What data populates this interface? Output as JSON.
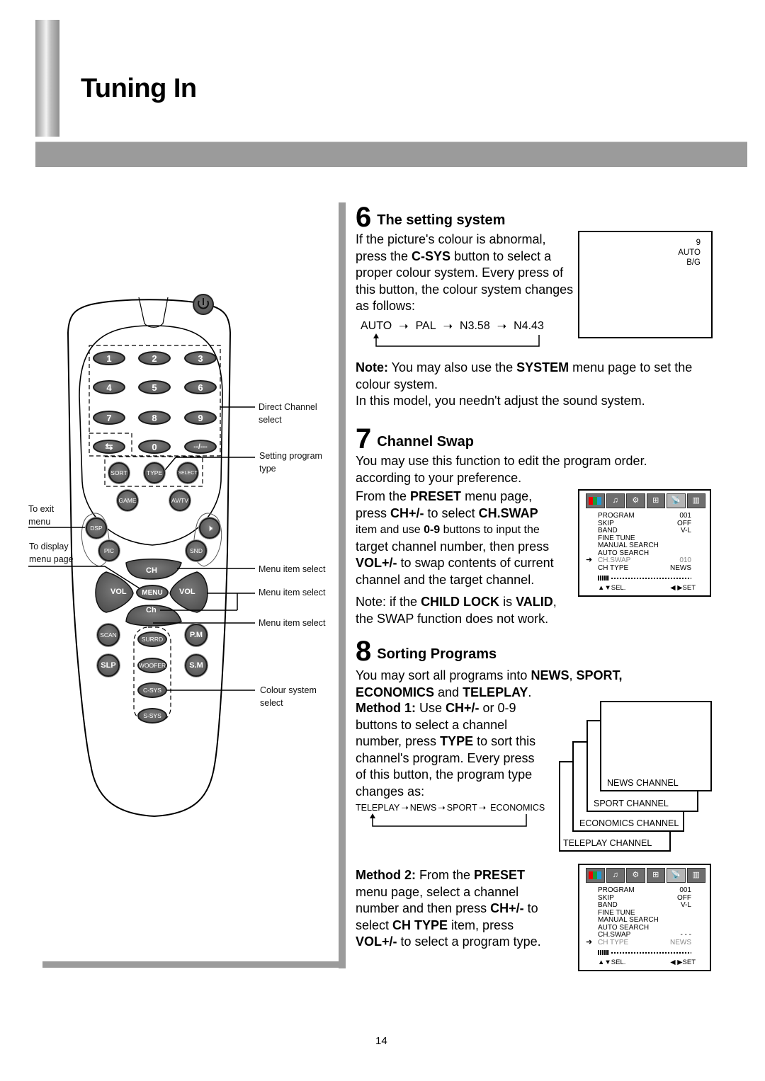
{
  "page": {
    "title": "Tuning In",
    "page_number": "14"
  },
  "remote": {
    "number_buttons": [
      "1",
      "2",
      "3",
      "4",
      "5",
      "6",
      "7",
      "8",
      "9"
    ],
    "row4_buttons": {
      "recall_icon": "recall-arrows-icon",
      "zero": "0",
      "digit_mode": "--/---"
    },
    "program_type_buttons": [
      "SORT",
      "TYPE",
      "SELECT"
    ],
    "mode_buttons": [
      "GAME",
      "AV/TV"
    ],
    "left_cluster": [
      "DSP",
      "PIC"
    ],
    "right_cluster": {
      "mute_icon": "mute-icon",
      "sound": "SND"
    },
    "dpad": {
      "ch_up": "CH",
      "ch_down": "Ch",
      "vol_left": "VOL",
      "vol_right": "VOL",
      "menu": "MENU"
    },
    "lower_left": [
      "SCAN",
      "SLP"
    ],
    "lower_center": [
      "SURRD",
      "WOOFER",
      "C-SYS",
      "S-SYS"
    ],
    "lower_right": [
      "P.M",
      "S.M"
    ],
    "callouts": {
      "direct_channel": "Direct Channel select",
      "setting_program": "Setting program type",
      "menu_item_1": "Menu item select",
      "menu_item_2": "Menu item select",
      "menu_item_3": "Menu item select",
      "colour_system": "Colour system select",
      "exit_menu": "To exit menu",
      "display_menu": "To display menu page"
    }
  },
  "section6": {
    "number": "6",
    "title": "The setting system",
    "p1_a": "If the picture's colour is abnormal, press the ",
    "p1_b": "C-SYS",
    "p1_c": " button to select a proper colour system. Every press of this button, the colour system changes as follows:",
    "sequence": [
      "AUTO",
      "PAL",
      "N3.58",
      "N4.43"
    ],
    "screen_lines": [
      "9",
      "AUTO",
      "B/G"
    ],
    "note_label": "Note:",
    "note_a": " You may also use the ",
    "note_b": "SYSTEM",
    "note_c": " menu page to set the colour system.",
    "note2": "In this model, you needn't adjust the sound system."
  },
  "section7": {
    "number": "7",
    "title": "Channel Swap",
    "intro": "You may use this function to edit the program order. according to your preference.",
    "t1": "From the ",
    "t1b": "PRESET",
    "t1c": " menu page,",
    "t2": "press ",
    "t2b": "CH+/-",
    "t2c": " to select ",
    "t2d": "CH.SWAP",
    "t3": "item and use ",
    "t3b": "0-9",
    "t3c": " buttons to input the",
    "t4": "target channel number, then press",
    "t5b": "VOL+/-",
    "t5c": " to swap contents of current",
    "t6": "channel and the target channel.",
    "note_a": "Note: if the ",
    "note_b": "CHILD LOCK",
    "note_c": " is ",
    "note_d": "VALID",
    "note_e": ",",
    "note2": "the SWAP function does not work.",
    "osd": {
      "rows": [
        {
          "label": "PROGRAM",
          "value": "001"
        },
        {
          "label": "SKIP",
          "value": "OFF"
        },
        {
          "label": "BAND",
          "value": "V-L"
        },
        {
          "label": "FINE TUNE",
          "value": ""
        },
        {
          "label": "MANUAL SEARCH",
          "value": ""
        },
        {
          "label": "AUTO SEARCH",
          "value": ""
        },
        {
          "label": "CH.SWAP",
          "value": "010"
        },
        {
          "label": "CH TYPE",
          "value": "NEWS"
        }
      ],
      "selected_row": "CH.SWAP",
      "foot_left": "▲▼SEL.",
      "foot_right": "◀ ▶SET"
    }
  },
  "section8": {
    "number": "8",
    "title": "Sorting Programs",
    "intro_a": "You may sort all programs into ",
    "intro_b": "NEWS",
    "intro_c": ", ",
    "intro_d": "SPORT,",
    "intro_e": "ECONOMICS",
    "intro_f": " and ",
    "intro_g": "TELEPLAY",
    "intro_h": ".",
    "m1_label": "Method 1:",
    "m1_a": " Use ",
    "m1_b": "CH+/-",
    "m1_c": " or 0-9",
    "m1_l2": "buttons to select a channel",
    "m1_l3a": "number, press ",
    "m1_l3b": "TYPE",
    "m1_l3c": " to sort this",
    "m1_l4": "channel's program. Every press",
    "m1_l5": "of this button, the program type",
    "m1_l6": "changes as:",
    "sequence": [
      "TELEPLAY",
      "NEWS",
      "SPORT",
      "ECONOMICS"
    ],
    "channel_screens": [
      "NEWS CHANNEL",
      "SPORT CHANNEL",
      "ECONOMICS CHANNEL",
      "TELEPLAY CHANNEL"
    ],
    "m2_label": "Method 2:",
    "m2_a": " From the ",
    "m2_b": "PRESET",
    "m2_l2": "menu page, select a channel",
    "m2_l3a": "number and then press ",
    "m2_l3b": "CH+/-",
    "m2_l3c": " to",
    "m2_l4a": "select ",
    "m2_l4b": "CH TYPE",
    "m2_l4c": " item, press",
    "m2_l5b": "VOL+/-",
    "m2_l5c": " to select a program type.",
    "osd": {
      "rows": [
        {
          "label": "PROGRAM",
          "value": "001"
        },
        {
          "label": "SKIP",
          "value": "OFF"
        },
        {
          "label": "BAND",
          "value": "V-L"
        },
        {
          "label": "FINE TUNE",
          "value": ""
        },
        {
          "label": "MANUAL SEARCH",
          "value": ""
        },
        {
          "label": "AUTO SEARCH",
          "value": ""
        },
        {
          "label": "CH.SWAP",
          "value": "- - -"
        },
        {
          "label": "CH TYPE",
          "value": "NEWS"
        }
      ],
      "selected_row": "CH TYPE",
      "foot_left": "▲▼SEL.",
      "foot_right": "◀ ▶SET"
    }
  },
  "osd_icons": [
    "picture-icon",
    "sound-icon",
    "function-icon",
    "preset-icon",
    "satellite-icon",
    "equalizer-icon"
  ],
  "colors": {
    "gray_bar": "#9b9b9b",
    "button_fill": "#5f5f5f"
  }
}
